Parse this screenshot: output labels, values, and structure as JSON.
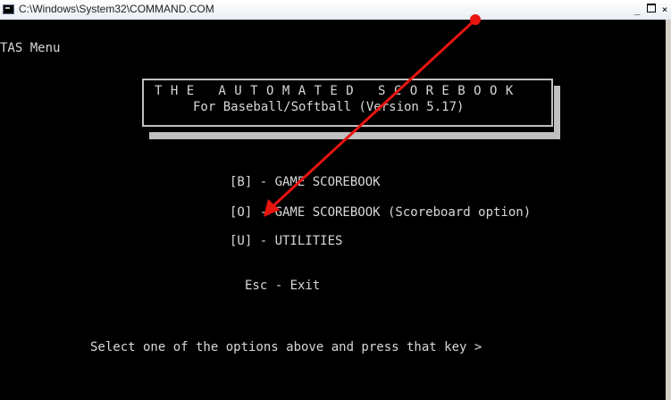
{
  "window": {
    "title": "C:\\Windows\\System32\\COMMAND.COM",
    "controls": {
      "minimize": "_",
      "maximize": "□",
      "close": "×"
    }
  },
  "console": {
    "heading": "TAS Menu",
    "banner": {
      "line1": "T H E   A U T O M A T E D   S C O R E B O O K",
      "line2": "For Baseball/Softball (Version 5.17)"
    },
    "options": [
      {
        "text": "[B] - GAME SCOREBOOK"
      },
      {
        "text": "[O] - GAME SCOREBOOK (Scoreboard option)"
      },
      {
        "text": "[U] - UTILITIES"
      }
    ],
    "exit": "Esc - Exit",
    "prompt": "Select one of the options above and press that key >"
  },
  "annotation": {
    "color": "#e8140f"
  }
}
